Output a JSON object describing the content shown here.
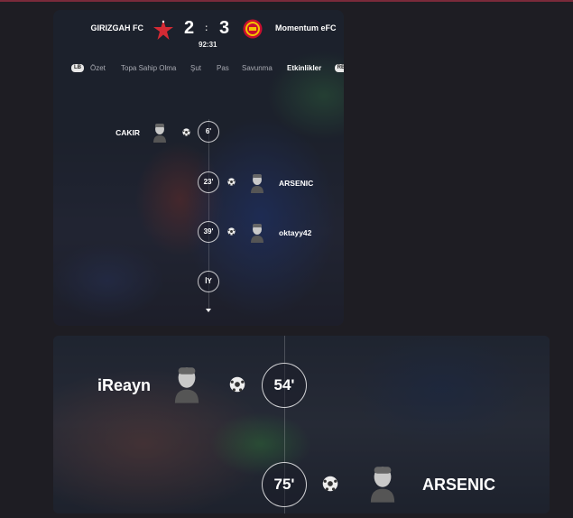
{
  "match": {
    "home_team": "GIRIZGAH FC",
    "away_team": "Momentum eFC",
    "home_score": "2",
    "separator": ":",
    "away_score": "3",
    "clock": "92:31"
  },
  "nav": {
    "left_button": "LB",
    "right_button": "RB",
    "tabs": [
      "Özet",
      "Topa Sahip Olma",
      "Şut",
      "Pas",
      "Savunma",
      "Etkinlikler"
    ],
    "active_tab": "Etkinlikler"
  },
  "events_panel": {
    "events": [
      {
        "minute": "6'",
        "player": "CAKIR",
        "side": "home",
        "icon": "soccer-ball-icon"
      },
      {
        "minute": "23'",
        "player": "ARSENIC",
        "side": "away",
        "icon": "soccer-ball-icon"
      },
      {
        "minute": "39'",
        "player": "oktayy42",
        "side": "away",
        "icon": "soccer-ball-icon"
      }
    ],
    "half_marker": "İY"
  },
  "zoomed_panel": {
    "events": [
      {
        "minute": "54'",
        "player": "iReayn",
        "side": "home",
        "icon": "soccer-ball-icon"
      },
      {
        "minute": "75'",
        "player": "ARSENIC",
        "side": "away",
        "icon": "soccer-ball-icon"
      }
    ]
  },
  "colors": {
    "accent_line": "#7a2a3a",
    "home_crest": "#d42a34",
    "away_crest": "#c8102e"
  }
}
